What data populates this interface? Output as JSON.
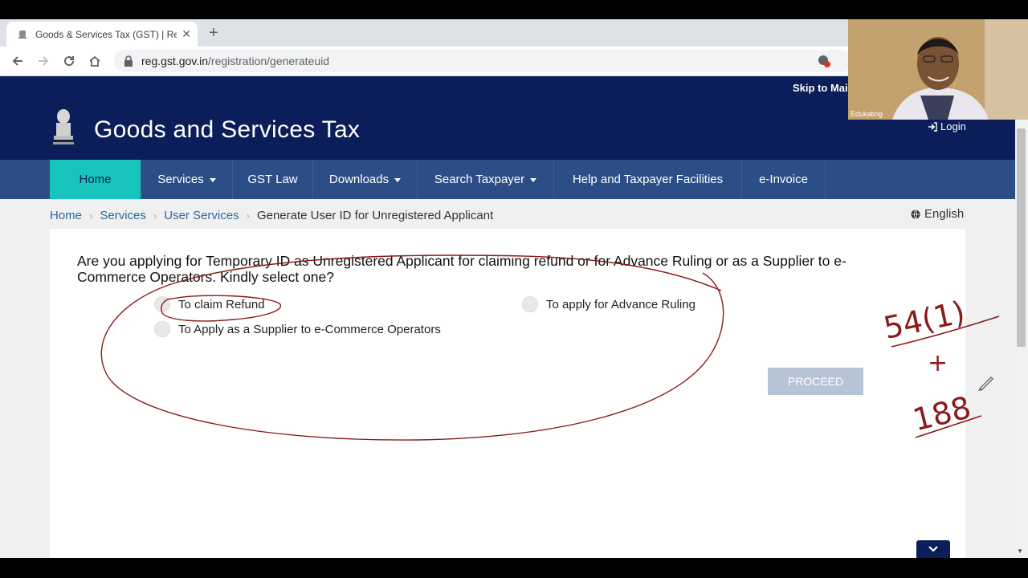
{
  "browser": {
    "tab_title": "Goods & Services Tax (GST) | Reg",
    "new_tab": "+",
    "tab_close": "✕",
    "url_domain": "reg.gst.gov.in",
    "url_path": "/registration/generateuid"
  },
  "site": {
    "skip_link": "Skip to Mai",
    "title": "Goods and Services Tax",
    "login": "Login",
    "emblem_caption": "सत्यमेव जयते"
  },
  "nav": {
    "items": [
      {
        "label": "Home",
        "dropdown": false,
        "active": true
      },
      {
        "label": "Services",
        "dropdown": true,
        "active": false
      },
      {
        "label": "GST Law",
        "dropdown": false,
        "active": false
      },
      {
        "label": "Downloads",
        "dropdown": true,
        "active": false
      },
      {
        "label": "Search Taxpayer",
        "dropdown": true,
        "active": false
      },
      {
        "label": "Help and Taxpayer Facilities",
        "dropdown": false,
        "active": false
      },
      {
        "label": "e-Invoice",
        "dropdown": false,
        "active": false
      }
    ]
  },
  "breadcrumb": {
    "items": [
      "Home",
      "Services",
      "User Services"
    ],
    "current": "Generate User ID for Unregistered Applicant"
  },
  "language": "English",
  "form": {
    "question": "Are you applying for Temporary ID as Unregistered Applicant for claiming refund or for Advance Ruling or as a Supplier to e-Commerce Operators. Kindly select one?",
    "options": {
      "refund": "To claim Refund",
      "advance_ruling": "To apply for Advance Ruling",
      "supplier": "To Apply as a Supplier to e-Commerce Operators"
    },
    "proceed_label": "PROCEED"
  },
  "annotation": {
    "handwriting_top": "54(1)",
    "handwriting_plus": "+",
    "handwriting_bottom": "188"
  },
  "webcam": {
    "name": "Edukating"
  },
  "colors": {
    "header_bg": "#0b1e59",
    "nav_bg": "#2c4e86",
    "nav_active": "#17c4bb",
    "proceed_bg": "#b7c4d6",
    "ink": "#8b1a1a"
  }
}
